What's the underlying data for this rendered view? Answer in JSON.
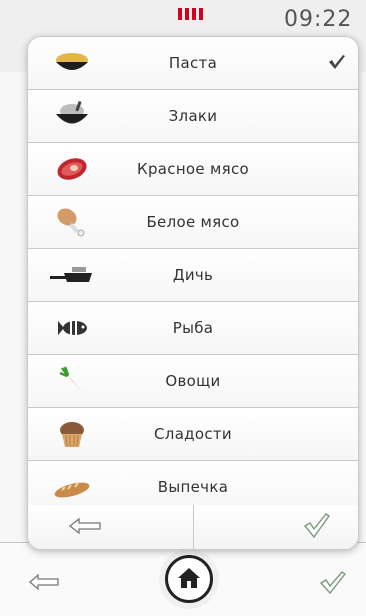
{
  "status_bar": {
    "time": "09:22"
  },
  "menu": {
    "items": [
      {
        "label": "Паста",
        "icon": "pasta-bowl-icon",
        "selected": true
      },
      {
        "label": "Злаки",
        "icon": "grain-bowl-icon",
        "selected": false
      },
      {
        "label": "Красное мясо",
        "icon": "steak-icon",
        "selected": false
      },
      {
        "label": "Белое мясо",
        "icon": "chicken-leg-icon",
        "selected": false
      },
      {
        "label": "Дичь",
        "icon": "frying-pan-icon",
        "selected": false
      },
      {
        "label": "Рыба",
        "icon": "fish-icon",
        "selected": false
      },
      {
        "label": "Овощи",
        "icon": "carrot-icon",
        "selected": false
      },
      {
        "label": "Сладости",
        "icon": "muffin-icon",
        "selected": false
      },
      {
        "label": "Выпечка",
        "icon": "bread-icon",
        "selected": false
      }
    ],
    "footer": {
      "back_icon": "back-arrow-icon",
      "confirm_icon": "check-icon"
    }
  },
  "bottom_nav": {
    "back_icon": "back-arrow-icon",
    "home_icon": "home-icon",
    "confirm_icon": "check-icon"
  },
  "colors": {
    "battery_red": "#d40020",
    "checkmark_green": "#6a8f6a"
  }
}
